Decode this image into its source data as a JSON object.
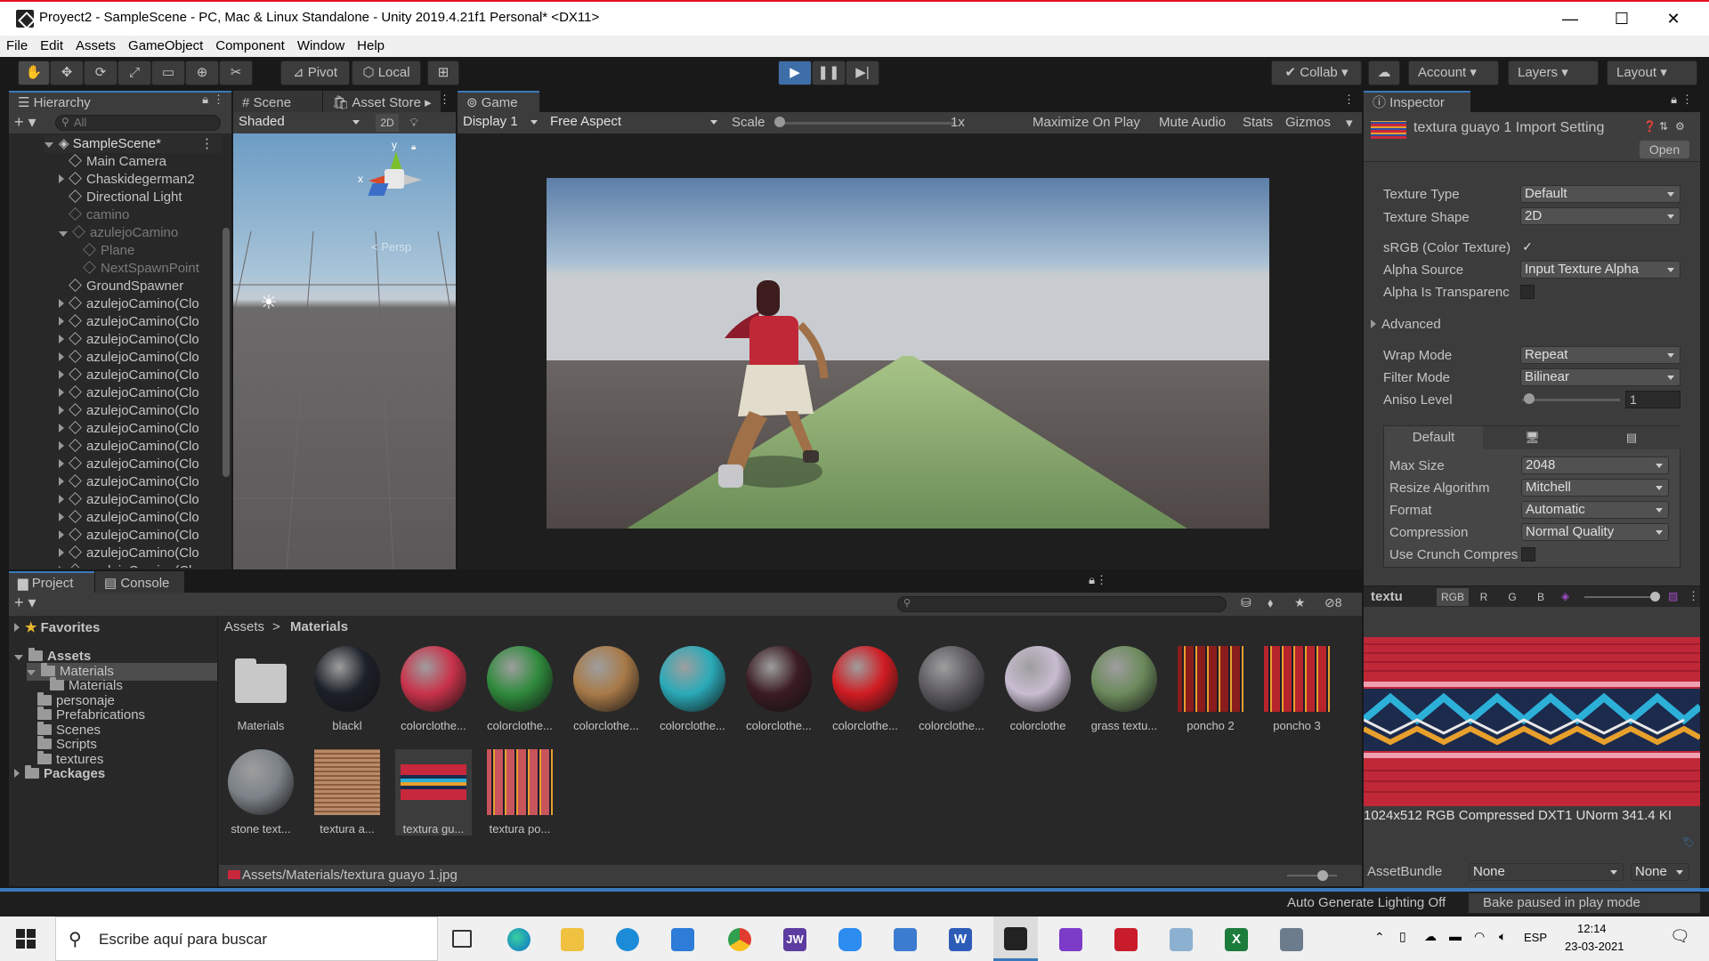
{
  "window": {
    "title": "Proyect2 - SampleScene - PC, Mac & Linux Standalone - Unity 2019.4.21f1 Personal* <DX11>",
    "minimize": "—",
    "maximize": "☐",
    "close": "✕"
  },
  "menu": [
    "File",
    "Edit",
    "Assets",
    "GameObject",
    "Component",
    "Window",
    "Help"
  ],
  "toolbar": {
    "pivot": "Pivot",
    "local": "Local",
    "collab": "Collab",
    "account": "Account",
    "layers": "Layers",
    "layout": "Layout"
  },
  "hierarchy": {
    "tab": "Hierarchy",
    "search_placeholder": "All",
    "scene": "SampleScene*",
    "items": [
      {
        "label": "Main Camera",
        "indent": 1,
        "arrow": false,
        "greyed": false
      },
      {
        "label": "Chaskidegerman2",
        "indent": 1,
        "arrow": true,
        "greyed": false
      },
      {
        "label": "Directional Light",
        "indent": 1,
        "arrow": false,
        "greyed": false
      },
      {
        "label": "camino",
        "indent": 1,
        "arrow": false,
        "greyed": true
      },
      {
        "label": "azulejoCamino",
        "indent": 1,
        "arrow": "down",
        "greyed": true
      },
      {
        "label": "Plane",
        "indent": 2,
        "arrow": false,
        "greyed": true
      },
      {
        "label": "NextSpawnPoint",
        "indent": 2,
        "arrow": false,
        "greyed": true
      },
      {
        "label": "GroundSpawner",
        "indent": 1,
        "arrow": false,
        "greyed": false
      },
      {
        "label": "azulejoCamino(Clo",
        "indent": 1,
        "arrow": true,
        "greyed": false
      },
      {
        "label": "azulejoCamino(Clo",
        "indent": 1,
        "arrow": true,
        "greyed": false
      },
      {
        "label": "azulejoCamino(Clo",
        "indent": 1,
        "arrow": true,
        "greyed": false
      },
      {
        "label": "azulejoCamino(Clo",
        "indent": 1,
        "arrow": true,
        "greyed": false
      },
      {
        "label": "azulejoCamino(Clo",
        "indent": 1,
        "arrow": true,
        "greyed": false
      },
      {
        "label": "azulejoCamino(Clo",
        "indent": 1,
        "arrow": true,
        "greyed": false
      },
      {
        "label": "azulejoCamino(Clo",
        "indent": 1,
        "arrow": true,
        "greyed": false
      },
      {
        "label": "azulejoCamino(Clo",
        "indent": 1,
        "arrow": true,
        "greyed": false
      },
      {
        "label": "azulejoCamino(Clo",
        "indent": 1,
        "arrow": true,
        "greyed": false
      },
      {
        "label": "azulejoCamino(Clo",
        "indent": 1,
        "arrow": true,
        "greyed": false
      },
      {
        "label": "azulejoCamino(Clo",
        "indent": 1,
        "arrow": true,
        "greyed": false
      },
      {
        "label": "azulejoCamino(Clo",
        "indent": 1,
        "arrow": true,
        "greyed": false
      },
      {
        "label": "azulejoCamino(Clo",
        "indent": 1,
        "arrow": true,
        "greyed": false
      },
      {
        "label": "azulejoCamino(Clo",
        "indent": 1,
        "arrow": true,
        "greyed": false
      },
      {
        "label": "azulejoCamino(Clo",
        "indent": 1,
        "arrow": true,
        "greyed": false
      },
      {
        "label": "azulejoCamino(Clo",
        "indent": 1,
        "arrow": true,
        "greyed": false
      }
    ]
  },
  "scene": {
    "tab": "Scene",
    "asset_store_tab": "Asset Store",
    "shading": "Shaded",
    "mode_2d": "2D",
    "gizmo_y": "y",
    "gizmo_x": "x",
    "persp": "< Persp"
  },
  "game": {
    "tab": "Game",
    "display": "Display 1",
    "aspect": "Free Aspect",
    "scale_label": "Scale",
    "scale_value": "1x",
    "maximize": "Maximize On Play",
    "mute": "Mute Audio",
    "stats": "Stats",
    "gizmos": "Gizmos"
  },
  "inspector": {
    "tab": "Inspector",
    "header": "textura guayo 1 Import Setting",
    "open": "Open",
    "texture_type_label": "Texture Type",
    "texture_type": "Default",
    "texture_shape_label": "Texture Shape",
    "texture_shape": "2D",
    "srgb_label": "sRGB (Color Texture)",
    "srgb_check": "✓",
    "alpha_source_label": "Alpha Source",
    "alpha_source": "Input Texture Alpha",
    "alpha_transp_label": "Alpha Is Transparenc",
    "advanced": "Advanced",
    "wrap_label": "Wrap Mode",
    "wrap": "Repeat",
    "filter_label": "Filter Mode",
    "filter": "Bilinear",
    "aniso_label": "Aniso Level",
    "aniso": "1",
    "platform_tab": "Default",
    "maxsize_label": "Max Size",
    "maxsize": "2048",
    "resize_label": "Resize Algorithm",
    "resize": "Mitchell",
    "format_label": "Format",
    "format": "Automatic",
    "compression_label": "Compression",
    "compression": "Normal Quality",
    "crunch_label": "Use Crunch Compres",
    "preview_title": "textu",
    "channels": [
      "RGB",
      "R",
      "G",
      "B"
    ],
    "preview_info": "1024x512  RGB Compressed DXT1 UNorm   341.4 KI",
    "assetbundle_label": "AssetBundle",
    "assetbundle": "None",
    "variant": "None"
  },
  "project": {
    "tab": "Project",
    "console_tab": "Console",
    "hidden_count": "8",
    "favorites": "Favorites",
    "tree": [
      {
        "label": "Assets",
        "indent": 0,
        "arrow": "down",
        "bold": true
      },
      {
        "label": "Materials",
        "indent": 1,
        "arrow": "down",
        "bold": false,
        "selected": true
      },
      {
        "label": "Materials",
        "indent": 2,
        "arrow": false,
        "bold": false
      },
      {
        "label": "personaje",
        "indent": 1,
        "arrow": false,
        "bold": false
      },
      {
        "label": "Prefabrications",
        "indent": 1,
        "arrow": false,
        "bold": false
      },
      {
        "label": "Scenes",
        "indent": 1,
        "arrow": false,
        "bold": false
      },
      {
        "label": "Scripts",
        "indent": 1,
        "arrow": false,
        "bold": false
      },
      {
        "label": "textures",
        "indent": 1,
        "arrow": false,
        "bold": false
      },
      {
        "label": "Packages",
        "indent": 0,
        "arrow": true,
        "bold": true
      }
    ],
    "breadcrumb_root": "Assets",
    "breadcrumb_sep": ">",
    "breadcrumb_current": "Materials",
    "assets": [
      {
        "label": "Materials",
        "kind": "folder",
        "color": "#c8c8c8"
      },
      {
        "label": "blackl",
        "kind": "sphere",
        "color": "#1c2028"
      },
      {
        "label": "colorclothe...",
        "kind": "sphere",
        "color": "#c8324a"
      },
      {
        "label": "colorclothe...",
        "kind": "sphere",
        "color": "#2f8a3c"
      },
      {
        "label": "colorclothe...",
        "kind": "sphere",
        "color": "#a87a48"
      },
      {
        "label": "colorclothe...",
        "kind": "sphere",
        "color": "#2aaab8"
      },
      {
        "label": "colorclothe...",
        "kind": "sphere",
        "color": "#3a1c22"
      },
      {
        "label": "colorclothe...",
        "kind": "sphere",
        "color": "#d01c22"
      },
      {
        "label": "colorclothe...",
        "kind": "sphere",
        "color": "#5c5a60"
      },
      {
        "label": "colorclothe",
        "kind": "sphere",
        "color": "#c8bcd0"
      },
      {
        "label": "grass textu...",
        "kind": "sphere",
        "color": "#6c8a5c"
      },
      {
        "label": "poncho 2",
        "kind": "stripes",
        "color": "#8a1c1c"
      },
      {
        "label": "poncho 3",
        "kind": "stripes",
        "color": "#b8242c"
      },
      {
        "label": "stone text...",
        "kind": "sphere",
        "color": "#7c8288"
      },
      {
        "label": "textura a...",
        "kind": "square",
        "color": "#b88a6a"
      },
      {
        "label": "textura gu...",
        "kind": "band",
        "color": "#c8283c"
      },
      {
        "label": "textura po...",
        "kind": "stripes",
        "color": "#c8545c"
      }
    ],
    "selected_path": "Assets/Materials/textura guayo 1.jpg"
  },
  "status": {
    "lighting": "Auto Generate Lighting Off",
    "bake": "Bake paused in play mode"
  },
  "taskbar": {
    "search_placeholder": "Escribe aquí para buscar",
    "lang": "ESP",
    "time": "12:14",
    "date": "23-03-2021"
  }
}
